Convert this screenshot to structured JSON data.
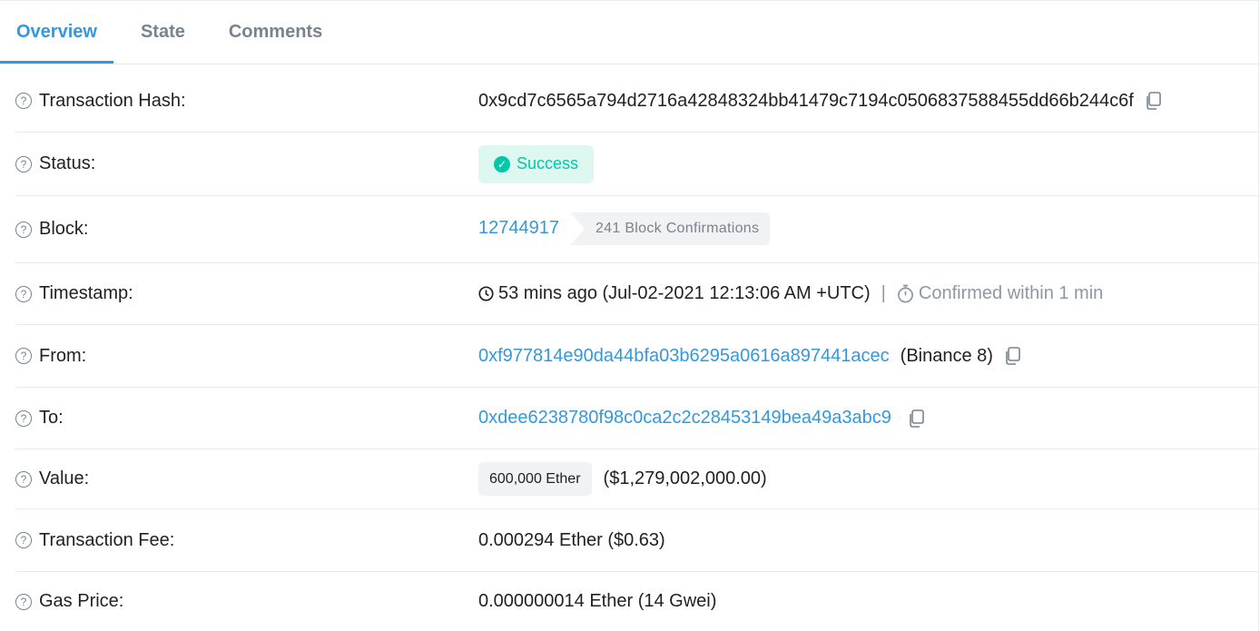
{
  "tabs": [
    {
      "label": "Overview"
    },
    {
      "label": "State"
    },
    {
      "label": "Comments"
    }
  ],
  "rows": {
    "hash": {
      "label": "Transaction Hash:",
      "value": "0x9cd7c6565a794d2716a42848324bb41479c7194c0506837588455dd66b244c6f"
    },
    "status": {
      "label": "Status:",
      "value": "Success"
    },
    "block": {
      "label": "Block:",
      "value": "12744917",
      "confirmations": "241 Block Confirmations"
    },
    "timestamp": {
      "label": "Timestamp:",
      "value": "53 mins ago (Jul-02-2021 12:13:06 AM +UTC)",
      "separator": "|",
      "confirmed": "Confirmed within 1 min"
    },
    "from": {
      "label": "From:",
      "address": "0xf977814e90da44bfa03b6295a0616a897441acec",
      "name": "(Binance 8)"
    },
    "to": {
      "label": "To:",
      "address": "0xdee6238780f98c0ca2c2c28453149bea49a3abc9"
    },
    "value": {
      "label": "Value:",
      "amount": "600,000 Ether",
      "usd": "($1,279,002,000.00)"
    },
    "fee": {
      "label": "Transaction Fee:",
      "value": "0.000294 Ether ($0.63)"
    },
    "gas": {
      "label": "Gas Price:",
      "value": "0.000000014 Ether (14 Gwei)"
    }
  },
  "icons": {
    "help": "question-circle-icon",
    "copy": "copy-icon",
    "check": "check-circle-icon",
    "clock": "clock-icon",
    "stopwatch": "stopwatch-icon"
  },
  "colors": {
    "accent": "#3498db",
    "success": "#00c9a7",
    "success_bg": "#def7f0",
    "muted": "#77838f"
  }
}
